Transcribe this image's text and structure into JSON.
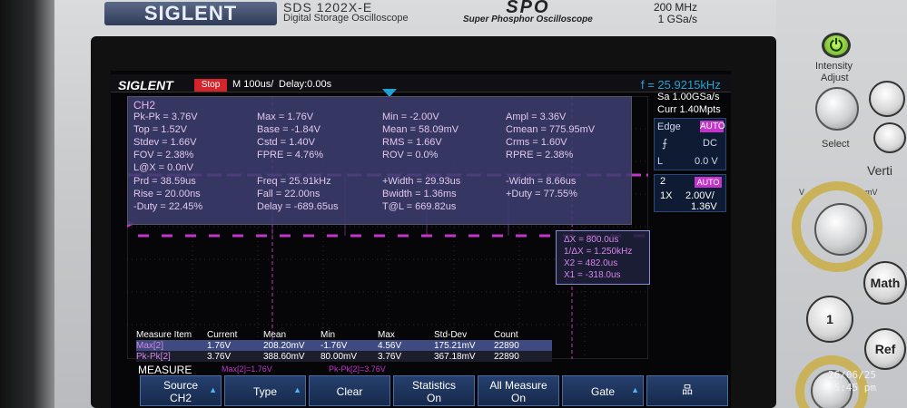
{
  "device": {
    "brand": "SIGLENT",
    "model": "SDS 1202X-E",
    "subtitle": "Digital Storage Oscilloscope",
    "logo_text": "SPO",
    "logo_sub": "Super Phosphor Oscilloscope",
    "spec_bw": "200 MHz",
    "spec_rate": "1 GSa/s",
    "intensity_label": "Intensity",
    "adjust_label": "Adjust",
    "select_label": "Select",
    "ref_label": "Ref",
    "math_label": "Math",
    "vert_label": "Verti",
    "one_label": "1"
  },
  "screen": {
    "logo": "SIGLENT",
    "status": "Stop",
    "timebase": "M 100us/",
    "delay": "Delay:0.00s",
    "freq": "f = 25.9215kHz",
    "sample_rate": "Sa 1.00GSa/s",
    "memory": "Curr 1.40Mpts",
    "trigger": {
      "type": "Edge",
      "source": "AUTO",
      "slope": "⨍",
      "coupling": "DC",
      "level_label": "L",
      "level": "0.0 V"
    },
    "channel": {
      "number": "2",
      "bw": "AUTO",
      "probe": "1X",
      "vdiv": "2.00V/",
      "offset": "1.36V"
    },
    "meas_title": "CH2",
    "measurements": [
      [
        "Pk-Pk = 3.76V",
        "Max = 1.76V",
        "Min = -2.00V",
        "Ampl = 3.36V"
      ],
      [
        "Top = 1.52V",
        "Base = -1.84V",
        "Mean = 58.09mV",
        "Cmean = 775.95mV"
      ],
      [
        "Stdev = 1.66V",
        "Cstd = 1.40V",
        "RMS = 1.66V",
        "Crms = 1.60V"
      ],
      [
        "FOV = 2.38%",
        "FPRE = 4.76%",
        "ROV = 0.0%",
        "RPRE = 2.38%"
      ],
      [
        "L@X = 0.0nV",
        "",
        "",
        ""
      ],
      [
        "Prd = 38.59us",
        "Freq = 25.91kHz",
        "+Width = 29.93us",
        "-Width = 8.66us"
      ],
      [
        "Rise = 20.00ns",
        "Fall = 22.00ns",
        "Bwidth = 1.36ms",
        "+Duty = 77.55%"
      ],
      [
        "-Duty = 22.45%",
        "Delay = -689.65us",
        "T@L = 669.82us",
        ""
      ]
    ],
    "cursor": {
      "dx": "ΔX = 800.0us",
      "inv_dx": "1/ΔX = 1.250kHz",
      "x2": "X2 = 482.0us",
      "x1": "X1 = -318.0us"
    },
    "stats": {
      "headers": [
        "Measure Item",
        "Current",
        "Mean",
        "Min",
        "Max",
        "Std-Dev",
        "Count"
      ],
      "rows": [
        [
          "Max[2]",
          "1.76V",
          "208.20mV",
          "-1.76V",
          "4.56V",
          "175.21mV",
          "22890"
        ],
        [
          "Pk-Pk[2]",
          "3.76V",
          "388.60mV",
          "80.00mV",
          "3.76V",
          "367.18mV",
          "22890"
        ]
      ]
    },
    "measure_label": "MEASURE",
    "mini1": "Max[2]=1.76V",
    "mini2": "Pk-Pk[2]=3.76V",
    "softkeys": [
      {
        "l1": "Source",
        "l2": "CH2"
      },
      {
        "l1": "Type",
        "l2": ""
      },
      {
        "l1": "Clear",
        "l2": ""
      },
      {
        "l1": "Statistics",
        "l2": "On"
      },
      {
        "l1": "All Measure",
        "l2": "On"
      },
      {
        "l1": "Gate",
        "l2": ""
      }
    ]
  },
  "timestamp": {
    "date": "26/06/25",
    "time": "5:45 pm"
  },
  "colors": {
    "trace": "#c235c9",
    "accent": "#1ea3d6",
    "panel": "#3c3e6e"
  }
}
